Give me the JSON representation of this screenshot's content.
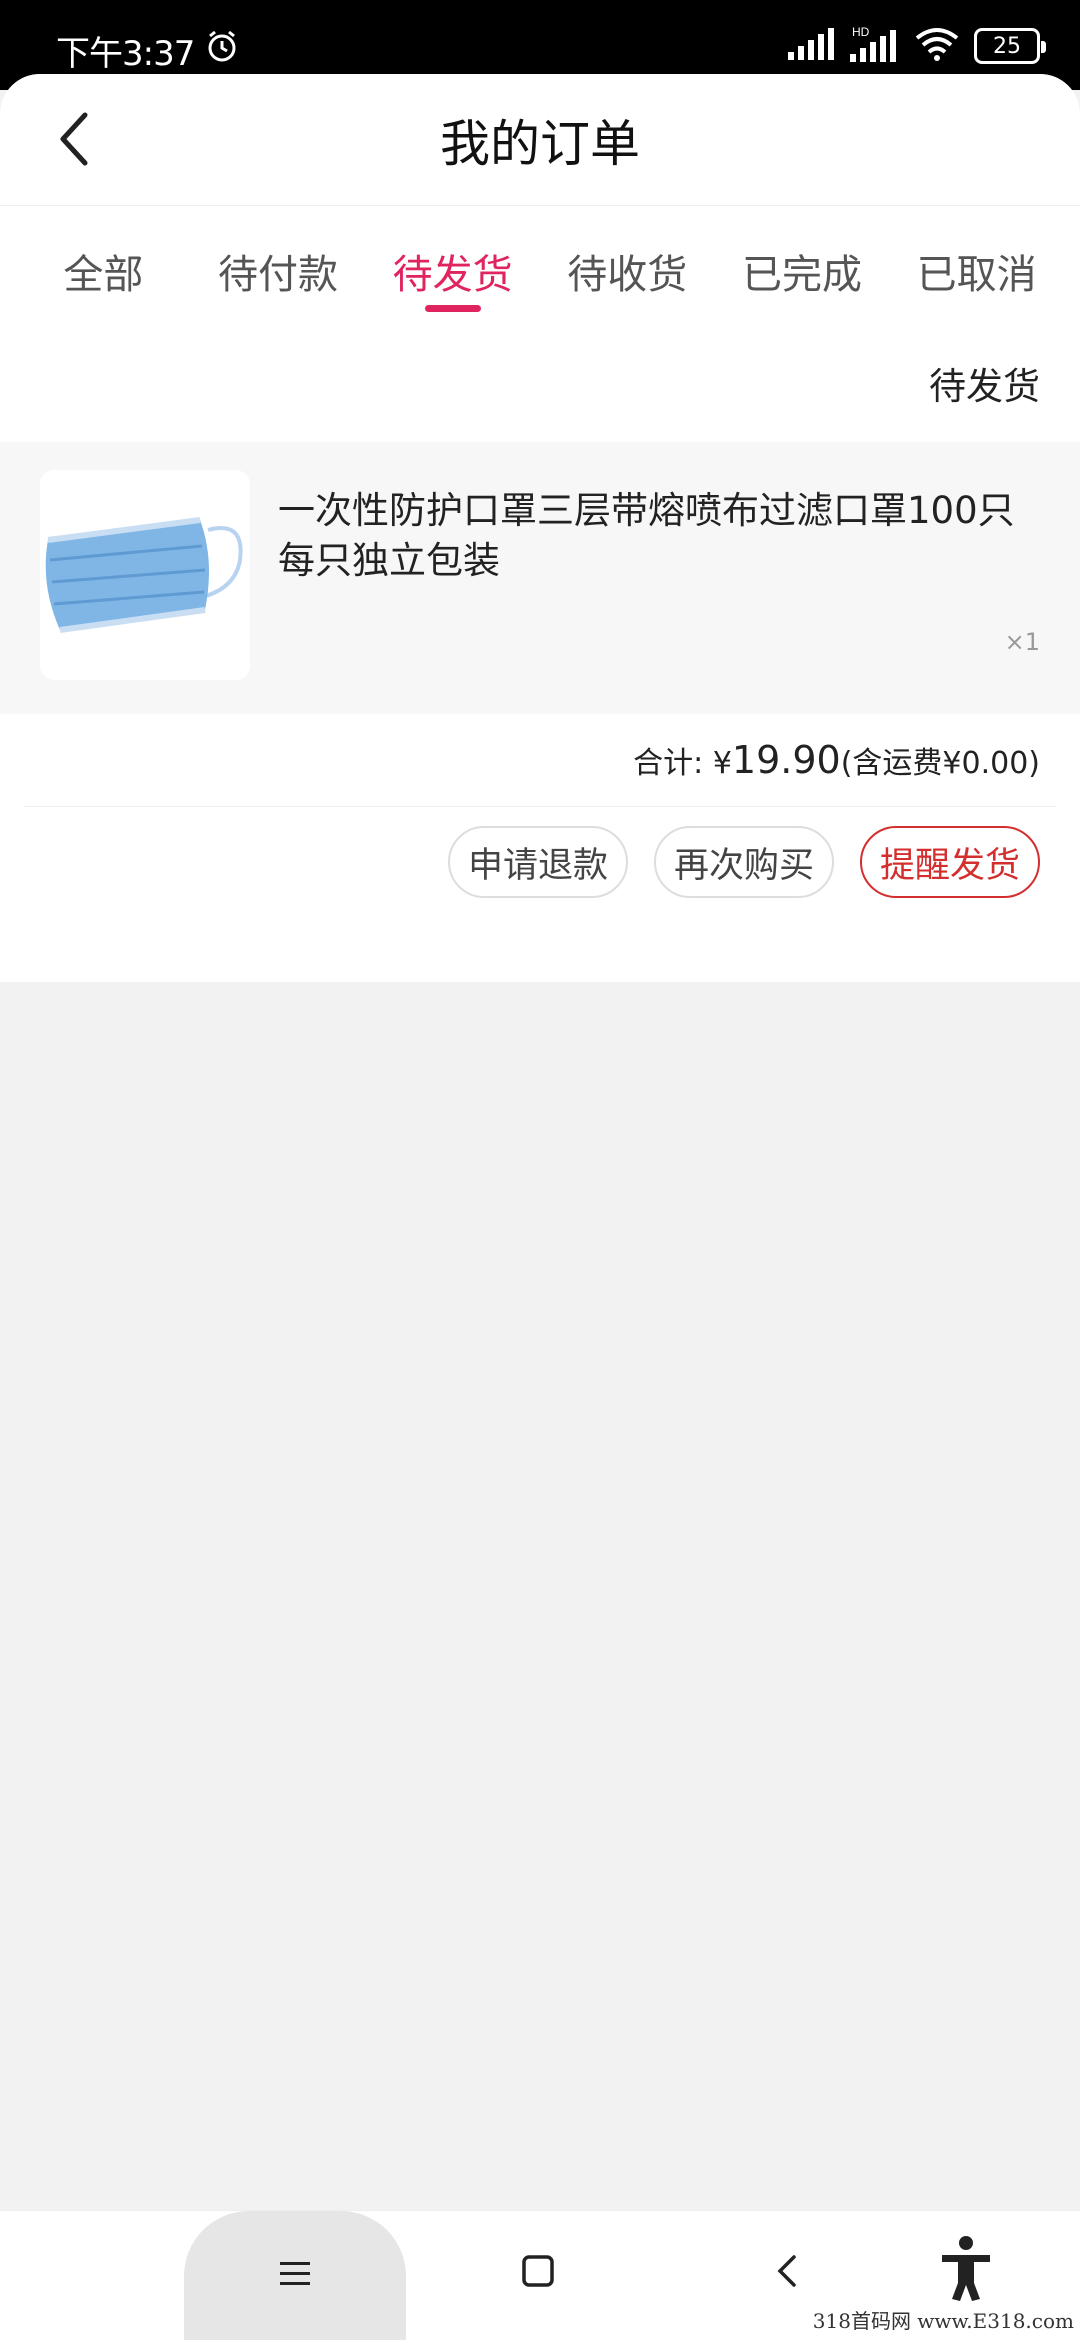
{
  "status_bar": {
    "time": "下午3:37",
    "battery": "25",
    "icons": [
      "alarm-icon",
      "signal-icon",
      "hd-signal-icon",
      "wifi-icon",
      "battery-icon"
    ]
  },
  "header": {
    "title": "我的订单",
    "back_icon": "chevron-left-icon"
  },
  "tabs": [
    {
      "label": "全部",
      "active": false
    },
    {
      "label": "待付款",
      "active": false
    },
    {
      "label": "待发货",
      "active": true
    },
    {
      "label": "待收货",
      "active": false
    },
    {
      "label": "已完成",
      "active": false
    },
    {
      "label": "已取消",
      "active": false
    }
  ],
  "order": {
    "status": "待发货",
    "product_name": "一次性防护口罩三层带熔喷布过滤口罩100只每只独立包装",
    "quantity": "×1",
    "total_label": "合计: ¥",
    "total_amount": "19.90",
    "shipping_note": "(含运费¥0.00)",
    "actions": {
      "refund": "申请退款",
      "rebuy": "再次购买",
      "remind": "提醒发货"
    }
  },
  "colors": {
    "accent": "#e0245e",
    "danger": "#d32f2f",
    "background": "#f2f2f2"
  },
  "navbar": {
    "icons": [
      "menu-icon",
      "home-square-icon",
      "back-chevron-icon",
      "accessibility-icon"
    ]
  },
  "watermark": "318首码网 www.E318.com"
}
